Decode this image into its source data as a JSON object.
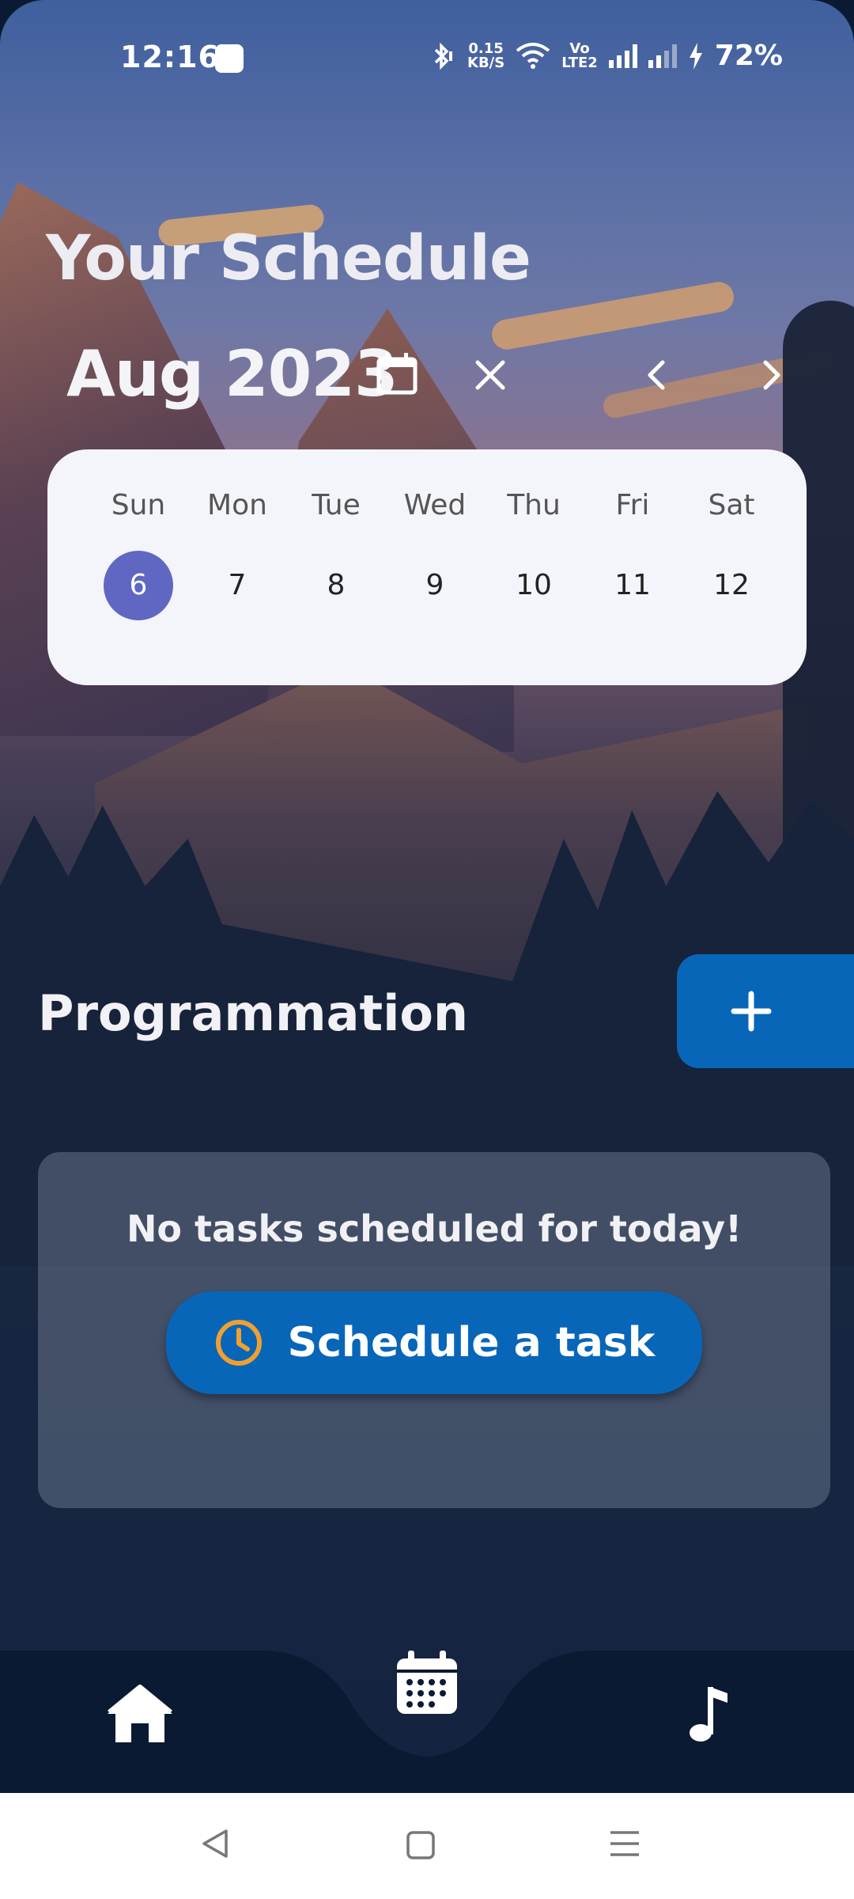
{
  "status_bar": {
    "time": "12:16",
    "net_speed_value": "0.15",
    "net_speed_unit": "KB/S",
    "volte_top": "Vo",
    "volte_bottom": "LTE2",
    "battery": "72%"
  },
  "header": {
    "title": "Your Schedule",
    "month_label": "Aug 2023"
  },
  "week": {
    "days": [
      "Sun",
      "Mon",
      "Tue",
      "Wed",
      "Thu",
      "Fri",
      "Sat"
    ],
    "dates": [
      "6",
      "7",
      "8",
      "9",
      "10",
      "11",
      "12"
    ],
    "selected_index": 0
  },
  "programmation": {
    "heading": "Programmation",
    "add_label": "+"
  },
  "empty_state": {
    "message": "No tasks scheduled for today!",
    "button_label": "Schedule a task"
  },
  "tabs": [
    "home-icon",
    "calendar-icon",
    "music-note-icon"
  ],
  "colors": {
    "accent_blue": "#0866b9",
    "selected_date": "#5f67c2",
    "clock_icon": "#f0a030",
    "tab_bar": "#0b1a33"
  }
}
